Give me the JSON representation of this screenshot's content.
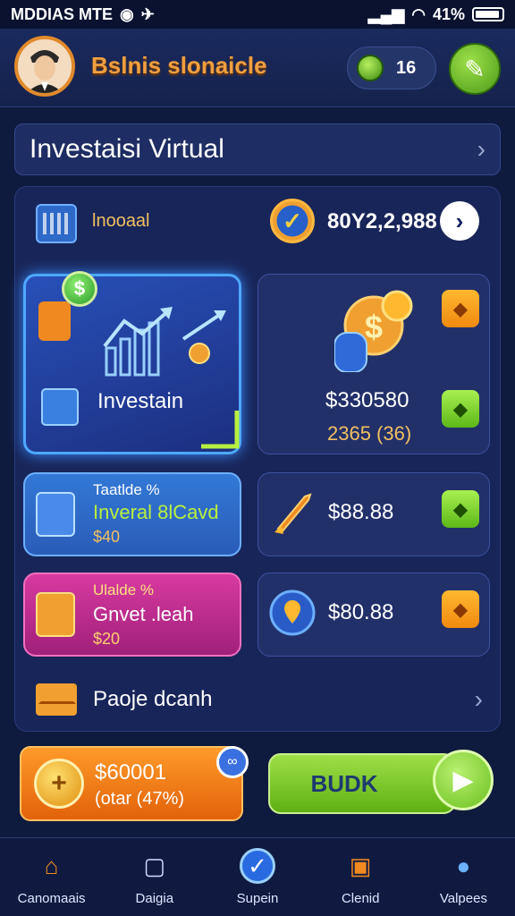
{
  "status_bar": {
    "carrier": "MDDIAS MTE",
    "battery": "41%"
  },
  "header": {
    "app_title": "Bslnis slonaicle",
    "coins": "16"
  },
  "section": {
    "title": "Investaisi Virtual"
  },
  "balance_row": {
    "label": "lnooaal",
    "value": "80Y2,2,988"
  },
  "invest_card": {
    "label": "Investain"
  },
  "right_card": {
    "value": "$330580",
    "sub_value": "2365 (36)"
  },
  "card_blue": {
    "title": "Taatlde %",
    "subtitle": "Inveral 8lCavd",
    "value": "$40"
  },
  "card_pink": {
    "title": "Ulalde %",
    "subtitle": "Gnvet .leah",
    "value": "$20"
  },
  "dark_cards": [
    {
      "value": "$88.88"
    },
    {
      "value": "$80.88"
    }
  ],
  "page_row": {
    "label": "Paoje dcanh"
  },
  "promo": {
    "amount": "$60001",
    "detail": "(otar (47%)"
  },
  "buy_button": {
    "label": "BUDK"
  },
  "nav": [
    {
      "label": "Canomaais",
      "icon": "home-icon"
    },
    {
      "label": "Daigia",
      "icon": "document-icon"
    },
    {
      "label": "Supein",
      "icon": "check-icon"
    },
    {
      "label": "Clenid",
      "icon": "basket-icon"
    },
    {
      "label": "Valpees",
      "icon": "user-icon"
    }
  ],
  "colors": {
    "accent_orange": "#f0a040",
    "accent_green": "#6cc020",
    "background": "#0f1a3f"
  }
}
